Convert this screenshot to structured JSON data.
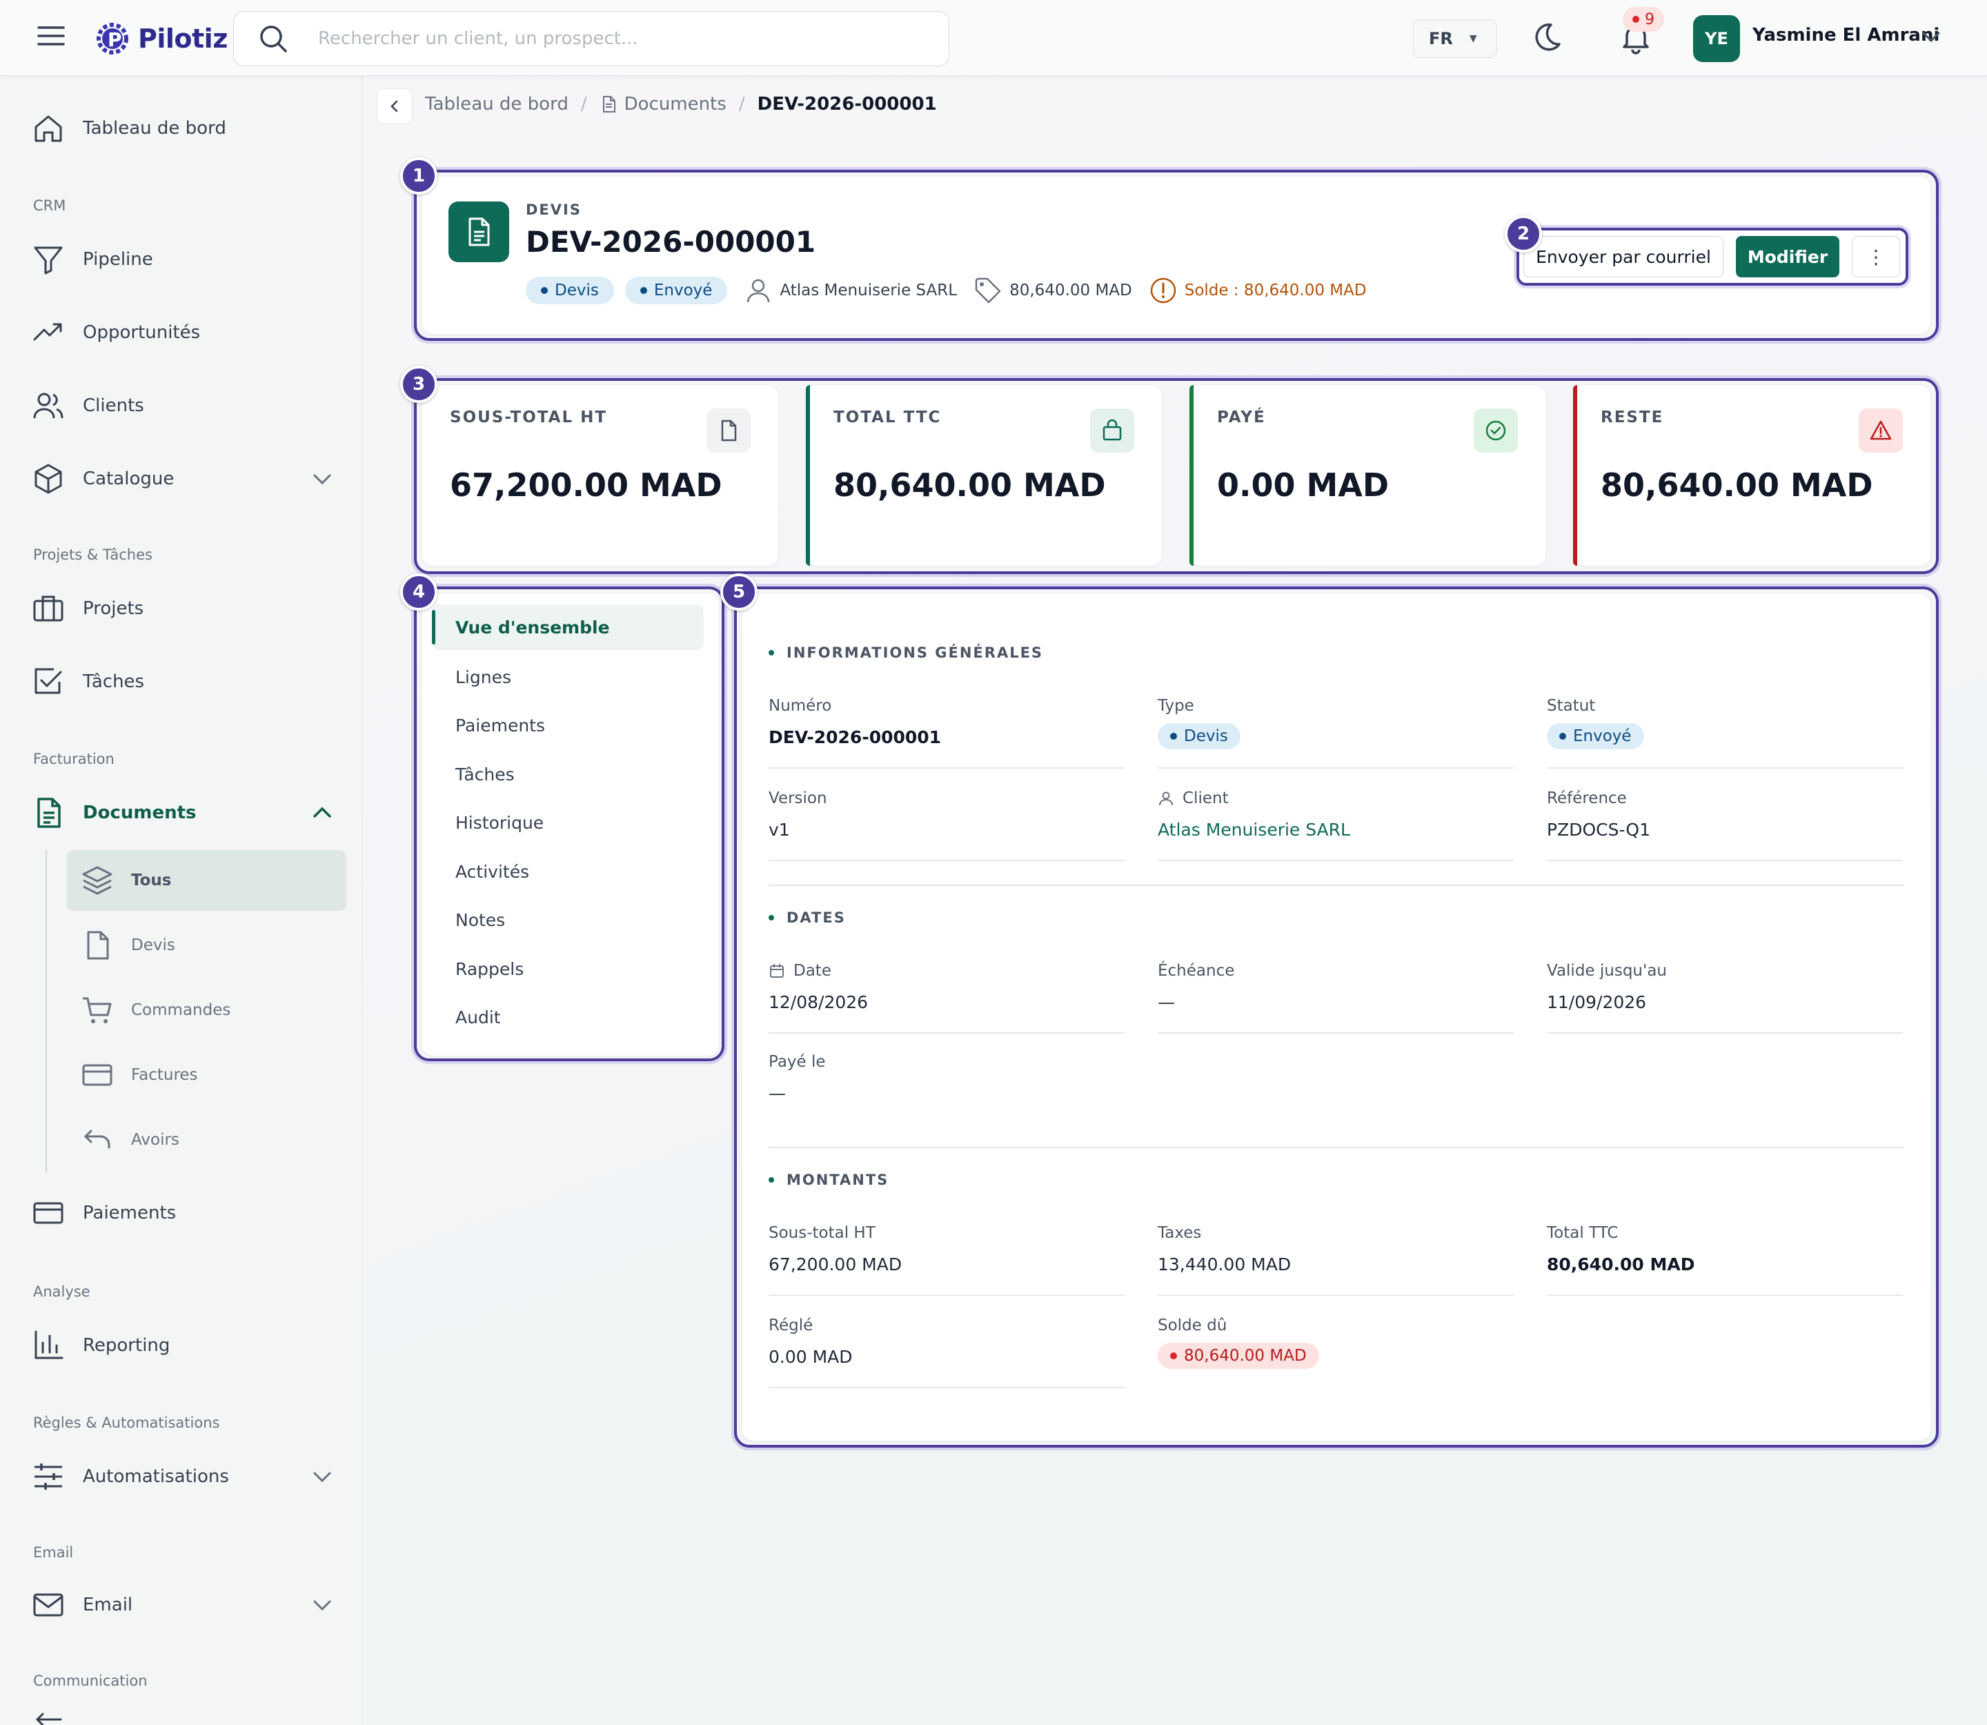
{
  "app": {
    "name": "Pilotiz"
  },
  "search": {
    "placeholder": "Rechercher un client, un prospect..."
  },
  "topbar": {
    "lang": "FR",
    "notifications": "9",
    "user_initials": "YE",
    "user_name": "Yasmine El Amrani"
  },
  "sidebar": {
    "dashboard": "Tableau de bord",
    "sections": {
      "crm": "CRM",
      "projects": "Projets & Tâches",
      "billing": "Facturation",
      "analysis": "Analyse",
      "rules": "Règles & Automatisations",
      "email": "Email",
      "communication": "Communication"
    },
    "items": {
      "pipeline": "Pipeline",
      "opportunities": "Opportunités",
      "clients": "Clients",
      "catalog": "Catalogue",
      "projects": "Projets",
      "tasks": "Tâches",
      "documents": "Documents",
      "payments": "Paiements",
      "reporting": "Reporting",
      "automations": "Automatisations",
      "email": "Email"
    },
    "documents_sub": {
      "all": "Tous",
      "quotes": "Devis",
      "orders": "Commandes",
      "invoices": "Factures",
      "credits": "Avoirs"
    }
  },
  "breadcrumb": {
    "home": "Tableau de bord",
    "documents": "Documents",
    "current": "DEV-2026-000001"
  },
  "markers": [
    "1",
    "2",
    "3",
    "4",
    "5"
  ],
  "document": {
    "kind": "DEVIS",
    "number": "DEV-2026-000001",
    "badges": {
      "type": "Devis",
      "status": "Envoyé"
    },
    "client": "Atlas Menuiserie SARL",
    "amount": "80,640.00 MAD",
    "balance": "Solde : 80,640.00 MAD"
  },
  "actions": {
    "email": "Envoyer par courriel",
    "edit": "Modifier",
    "more": "⋮"
  },
  "stats": [
    {
      "label": "SOUS-TOTAL HT",
      "value": "67,200.00 MAD"
    },
    {
      "label": "TOTAL TTC",
      "value": "80,640.00 MAD"
    },
    {
      "label": "PAYÉ",
      "value": "0.00 MAD"
    },
    {
      "label": "RESTE",
      "value": "80,640.00 MAD"
    }
  ],
  "tabs": [
    "Vue d'ensemble",
    "Lignes",
    "Paiements",
    "Tâches",
    "Historique",
    "Activités",
    "Notes",
    "Rappels",
    "Audit"
  ],
  "general": {
    "title": "INFORMATIONS GÉNÉRALES",
    "number_label": "Numéro",
    "number": "DEV-2026-000001",
    "type_label": "Type",
    "type": "Devis",
    "status_label": "Statut",
    "status": "Envoyé",
    "version_label": "Version",
    "version": "v1",
    "client_label": "Client",
    "client": "Atlas Menuiserie SARL",
    "reference_label": "Référence",
    "reference": "PZDOCS-Q1"
  },
  "dates": {
    "title": "DATES",
    "date_label": "Date",
    "date": "12/08/2026",
    "due_label": "Échéance",
    "due": "—",
    "valid_label": "Valide jusqu'au",
    "valid": "11/09/2026",
    "paid_label": "Payé le",
    "paid": "—"
  },
  "amounts": {
    "title": "MONTANTS",
    "subtotal_label": "Sous-total HT",
    "subtotal": "67,200.00 MAD",
    "taxes_label": "Taxes",
    "taxes": "13,440.00 MAD",
    "total_label": "Total TTC",
    "total": "80,640.00 MAD",
    "settled_label": "Réglé",
    "settled": "0.00 MAD",
    "due_label": "Solde dû",
    "due": "80,640.00 MAD"
  },
  "colors": {
    "brand": "#0f6b57",
    "frame": "#4c3b9a",
    "danger": "#b91c1c",
    "accent_dark": "#0f5e4c"
  }
}
